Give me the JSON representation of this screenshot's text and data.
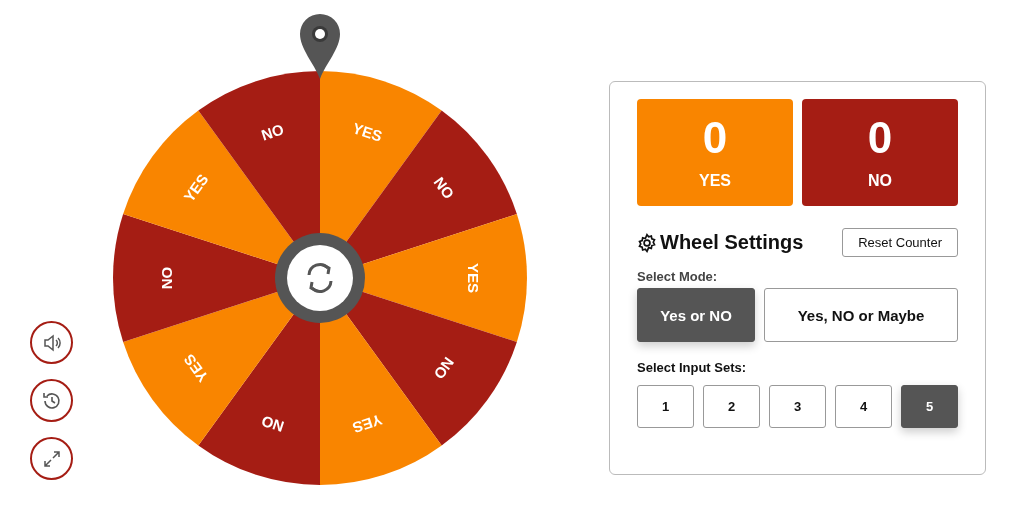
{
  "wheel": {
    "segments": [
      {
        "label": "YES",
        "color": "#f98500"
      },
      {
        "label": "NO",
        "color": "#a51d14"
      },
      {
        "label": "YES",
        "color": "#f98500"
      },
      {
        "label": "NO",
        "color": "#a51d14"
      },
      {
        "label": "YES",
        "color": "#f98500"
      },
      {
        "label": "NO",
        "color": "#a51d14"
      },
      {
        "label": "YES",
        "color": "#f98500"
      },
      {
        "label": "NO",
        "color": "#a51d14"
      },
      {
        "label": "YES",
        "color": "#f98500"
      },
      {
        "label": "NO",
        "color": "#a51d14"
      }
    ]
  },
  "counters": [
    {
      "value": "0",
      "label": "YES",
      "color": "#f98500"
    },
    {
      "value": "0",
      "label": "NO",
      "color": "#a51d14"
    }
  ],
  "settings": {
    "title": "Wheel Settings",
    "reset": "Reset Counter",
    "mode_label": "Select Mode:",
    "modes": [
      {
        "label": "Yes or NO",
        "selected": true
      },
      {
        "label": "Yes, NO or Maybe",
        "selected": false
      }
    ],
    "sets_label": "Select Input Sets:",
    "sets": [
      {
        "label": "1",
        "selected": false
      },
      {
        "label": "2",
        "selected": false
      },
      {
        "label": "3",
        "selected": false
      },
      {
        "label": "4",
        "selected": false
      },
      {
        "label": "5",
        "selected": true
      }
    ]
  }
}
